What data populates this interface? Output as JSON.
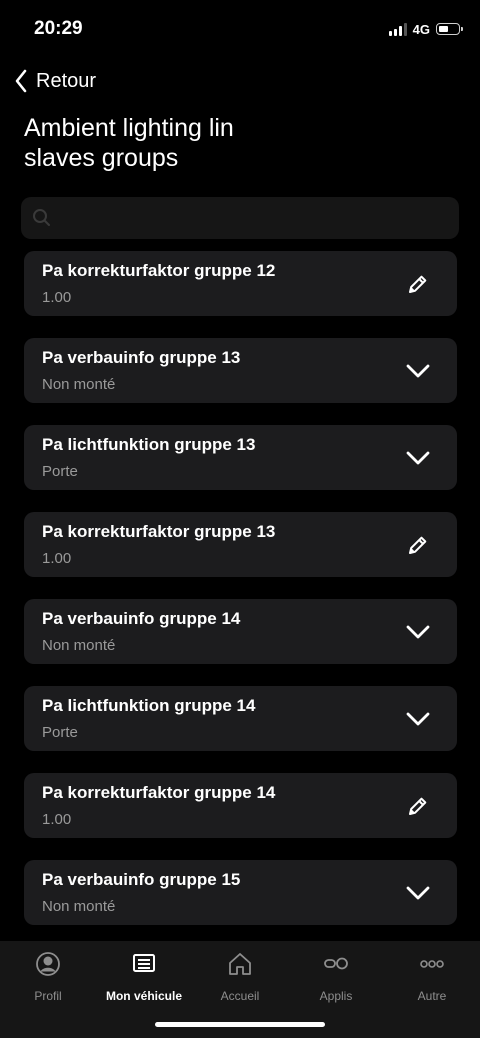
{
  "status": {
    "time": "20:29",
    "network": "4G",
    "battery_level": 0.55
  },
  "nav": {
    "back_label": "Retour"
  },
  "page": {
    "title_line1": "Ambient lighting lin",
    "title_line2": "slaves groups"
  },
  "search": {
    "placeholder": "",
    "value": ""
  },
  "items": [
    {
      "title": "Pa korrekturfaktor gruppe 12",
      "value": "1.00",
      "action": "pencil-icon"
    },
    {
      "title": "Pa verbauinfo gruppe 13",
      "value": "Non monté",
      "action": "chevron-down-icon"
    },
    {
      "title": "Pa lichtfunktion gruppe 13",
      "value": "Porte",
      "action": "chevron-down-icon"
    },
    {
      "title": "Pa korrekturfaktor gruppe 13",
      "value": "1.00",
      "action": "pencil-icon"
    },
    {
      "title": "Pa verbauinfo gruppe 14",
      "value": "Non monté",
      "action": "chevron-down-icon"
    },
    {
      "title": "Pa lichtfunktion gruppe 14",
      "value": "Porte",
      "action": "chevron-down-icon"
    },
    {
      "title": "Pa korrekturfaktor gruppe 14",
      "value": "1.00",
      "action": "pencil-icon"
    },
    {
      "title": "Pa verbauinfo gruppe 15",
      "value": "Non monté",
      "action": "chevron-down-icon"
    }
  ],
  "tabbar": {
    "active": "Mon véhicule",
    "tabs": [
      {
        "label": "Profil",
        "icon": "profile-icon"
      },
      {
        "label": "Mon véhicule",
        "icon": "vehicle-icon"
      },
      {
        "label": "Accueil",
        "icon": "home-icon"
      },
      {
        "label": "Applis",
        "icon": "apps-icon"
      },
      {
        "label": "Autre",
        "icon": "more-icon"
      }
    ]
  },
  "colors": {
    "background": "#000000",
    "card": "#1c1c1e",
    "secondary_text": "#9a9a9a",
    "tabbar": "#161616"
  }
}
